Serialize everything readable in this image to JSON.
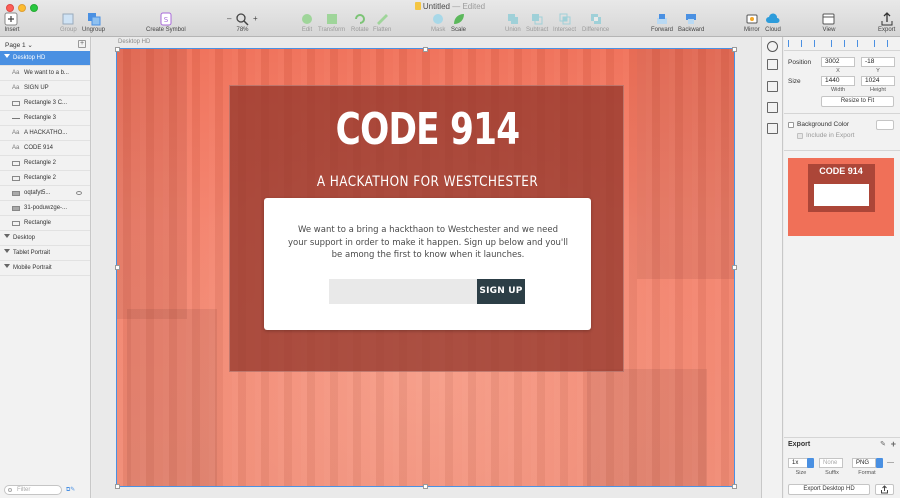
{
  "window": {
    "title": "Untitled",
    "status": "— Edited"
  },
  "toolbar": {
    "insert": "Insert",
    "group": "Group",
    "ungroup": "Ungroup",
    "create_symbol": "Create Symbol",
    "zoom_minus": "–",
    "zoom_plus": "+",
    "zoom_level": "78%",
    "edit": "Edit",
    "transform": "Transform",
    "rotate": "Rotate",
    "flatten": "Flatten",
    "mask": "Mask",
    "scale": "Scale",
    "union": "Union",
    "subtract": "Subtract",
    "intersect": "Intersect",
    "difference": "Difference",
    "forward": "Forward",
    "backward": "Backward",
    "mirror": "Mirror",
    "cloud": "Cloud",
    "view": "View",
    "export": "Export"
  },
  "layers": {
    "page": "Page 1",
    "artboards": [
      {
        "name": "Desktop HD",
        "expanded": true
      },
      {
        "name": "Desktop"
      },
      {
        "name": "Tablet Portrait"
      },
      {
        "name": "Mobile Portrait"
      }
    ],
    "children": [
      {
        "name": "We want to a b...",
        "type": "text",
        "icon_text": "Aa"
      },
      {
        "name": "SIGN UP",
        "type": "text",
        "icon_text": "Aa"
      },
      {
        "name": "Rectangle 3 C...",
        "type": "rect"
      },
      {
        "name": "Rectangle 3",
        "type": "line"
      },
      {
        "name": "A HACKATHO...",
        "type": "text",
        "icon_text": "Aa"
      },
      {
        "name": "CODE 914",
        "type": "text",
        "icon_text": "Aa"
      },
      {
        "name": "Rectangle 2",
        "type": "rect"
      },
      {
        "name": "Rectangle 2",
        "type": "rect"
      },
      {
        "name": "oqtafyt5...",
        "type": "image"
      },
      {
        "name": "31-poduwzge-...",
        "type": "image"
      },
      {
        "name": "Rectangle",
        "type": "rect"
      }
    ],
    "filter_placeholder": "Filter"
  },
  "canvas": {
    "artboard_label": "Desktop HD",
    "hero_title": "CODE 914",
    "hero_subtitle": "A HACKATHON FOR WESTCHESTER",
    "card_text": "We want to a bring  a hackthaon to Westchester and we need your support in order to make it happen. Sign up below and you'll be among the first to know when it launches.",
    "signup_label": "SIGN UP",
    "accent_color": "#f07058",
    "button_color": "#2c3e46"
  },
  "inspector": {
    "position_label": "Position",
    "x_value": "3002",
    "y_value": "-18",
    "x_label": "X",
    "y_label": "Y",
    "size_label": "Size",
    "width_value": "1440",
    "height_value": "1024",
    "width_label": "Width",
    "height_label": "Height",
    "resize_button": "Resize to Fit",
    "bg_color_label": "Background Color",
    "include_export_label": "Include in Export",
    "preview_title": "CODE 914",
    "export_title": "Export",
    "export_size": "1x",
    "export_suffix_placeholder": "None",
    "export_format": "PNG",
    "export_size_label": "Size",
    "export_suffix_label": "Suffix",
    "export_format_label": "Format",
    "export_button": "Export Desktop HD"
  }
}
